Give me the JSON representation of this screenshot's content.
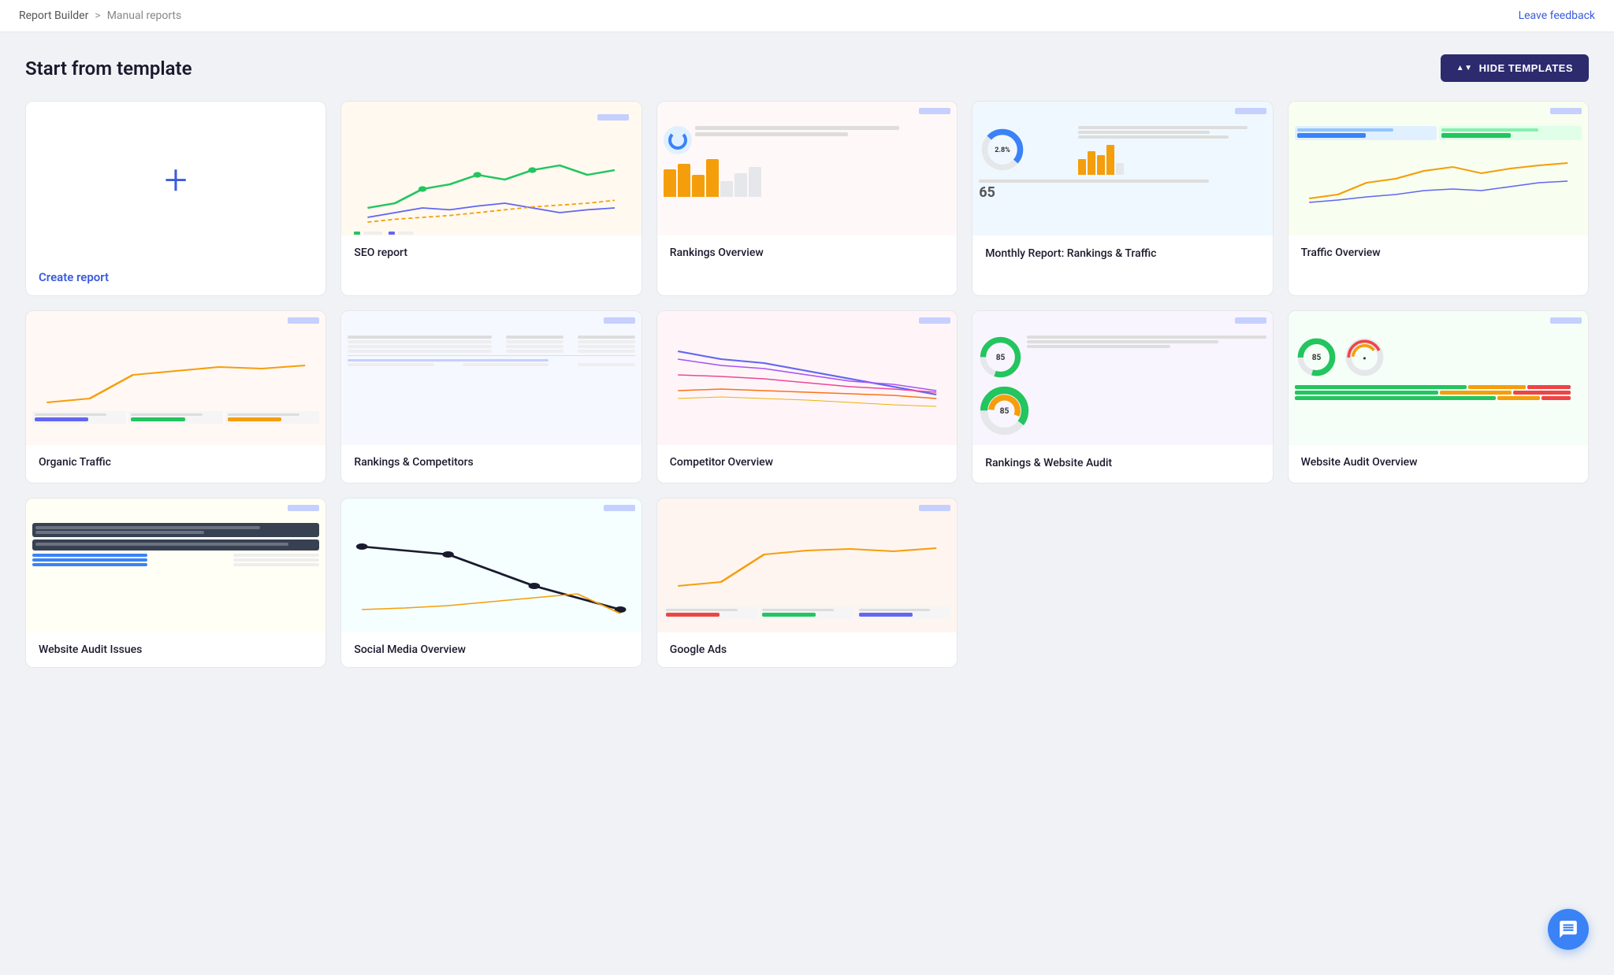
{
  "topbar": {
    "breadcrumb_root": "Report Builder",
    "breadcrumb_sep": ">",
    "breadcrumb_current": "Manual reports",
    "leave_feedback": "Leave feedback"
  },
  "section": {
    "title": "Start from template",
    "hide_btn": "HIDE TEMPLATES"
  },
  "templates": [
    {
      "id": "create",
      "label": "Create report",
      "type": "create"
    },
    {
      "id": "seo",
      "label": "SEO report",
      "type": "seo"
    },
    {
      "id": "rankings-overview",
      "label": "Rankings Overview",
      "type": "rankings-overview"
    },
    {
      "id": "monthly-report",
      "label": "Monthly Report: Rankings & Traffic",
      "type": "monthly"
    },
    {
      "id": "traffic-overview",
      "label": "Traffic Overview",
      "type": "traffic-overview"
    },
    {
      "id": "organic-traffic",
      "label": "Organic Traffic",
      "type": "organic"
    },
    {
      "id": "rankings-competitors",
      "label": "Rankings & Competitors",
      "type": "rankings-comp"
    },
    {
      "id": "competitor-overview",
      "label": "Competitor Overview",
      "type": "competitor"
    },
    {
      "id": "rankings-audit",
      "label": "Rankings & Website Audit",
      "type": "rankings-audit"
    },
    {
      "id": "website-audit-overview",
      "label": "Website Audit Overview",
      "type": "website-audit"
    },
    {
      "id": "website-audit-issues",
      "label": "Website Audit Issues",
      "type": "website-issues"
    },
    {
      "id": "social-media",
      "label": "Social Media Overview",
      "type": "social-media"
    },
    {
      "id": "google-ads",
      "label": "Google Ads",
      "type": "google-ads"
    }
  ]
}
